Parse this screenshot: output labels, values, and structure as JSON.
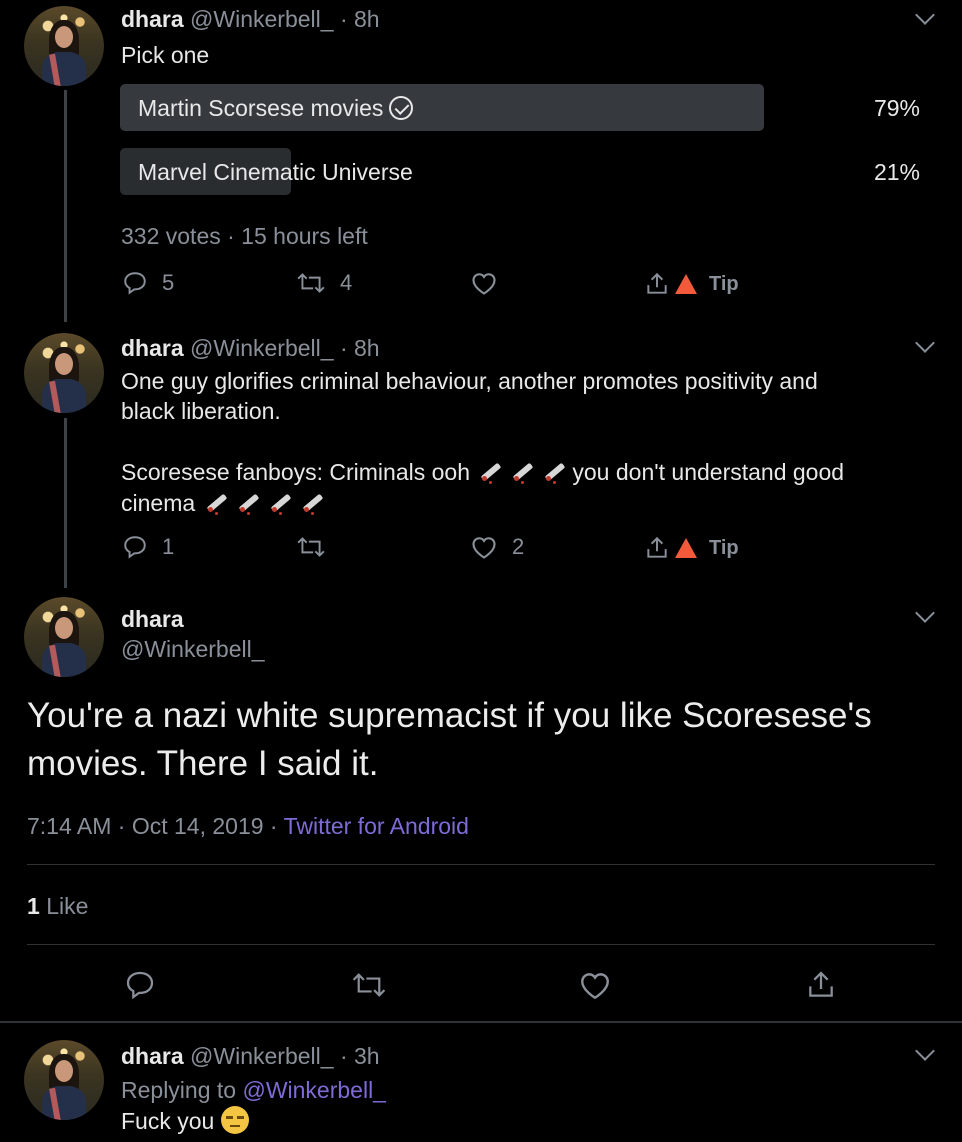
{
  "tweet1": {
    "name": "dhara",
    "handle": "@Winkerbell_",
    "time": "· 8h",
    "text": "Pick one",
    "poll": {
      "options": [
        {
          "label": "Martin Scorsese movies",
          "percent_label": "79%",
          "percent": 79,
          "winner": true
        },
        {
          "label": "Marvel Cinematic Universe",
          "percent_label": "21%",
          "percent": 21,
          "winner": false
        }
      ],
      "meta": "332 votes · 15 hours left"
    },
    "actions": {
      "reply_count": "5",
      "retweet_count": "4",
      "like_count": "",
      "tip_label": "Tip"
    }
  },
  "tweet2": {
    "name": "dhara",
    "handle": "@Winkerbell_",
    "time": "· 8h",
    "line1": "One guy glorifies criminal behaviour, another promotes positivity and",
    "line2": "black liberation.",
    "line3a": "Scoresese fanboys: Criminals ooh ",
    "line3b": "you don't understand good",
    "line4": "cinema",
    "actions": {
      "reply_count": "1",
      "retweet_count": "",
      "like_count": "2",
      "tip_label": "Tip"
    }
  },
  "main_tweet": {
    "name": "dhara",
    "handle": "@Winkerbell_",
    "text": "You're a nazi white supremacist if you like Scoresese's movies. There I said it.",
    "timestamp": "7:14 AM · Oct 14, 2019 · ",
    "source": "Twitter for Android",
    "likes_count": "1",
    "likes_label": "Like"
  },
  "reply": {
    "name": "dhara",
    "handle": "@Winkerbell_",
    "time": "· 3h",
    "replying_prefix": "Replying to ",
    "replying_handle": "@Winkerbell_",
    "text": "Fuck you "
  },
  "colors": {
    "background": "#000000",
    "accent": "#7f6bd6",
    "muted": "#8a9099",
    "poll_winner": "#363a3e",
    "poll_loser": "#2a2d30"
  },
  "icons": [
    "reply-icon",
    "retweet-icon",
    "like-icon",
    "share-icon",
    "brave-tip-icon",
    "chevron-down-icon",
    "check-circle-icon",
    "syringe-emoji",
    "unamused-face-emoji"
  ]
}
